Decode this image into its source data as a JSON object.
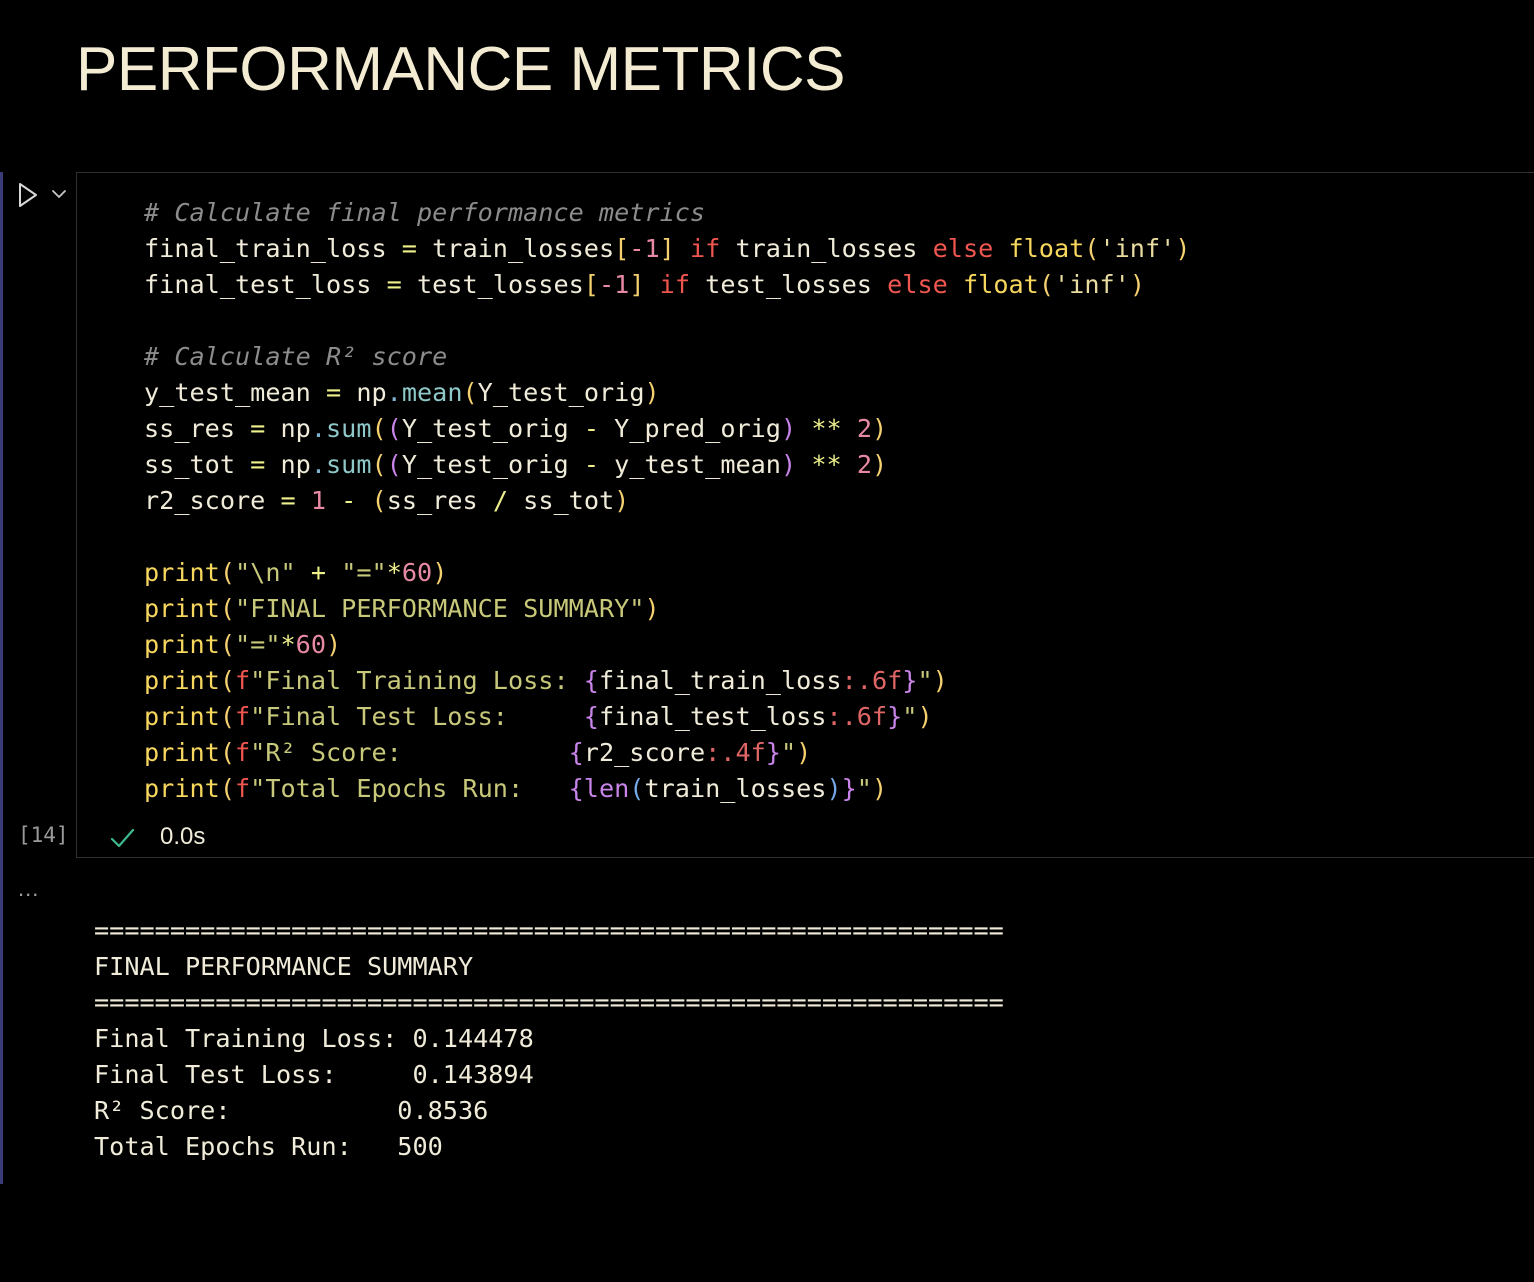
{
  "heading": "PERFORMANCE METRICS",
  "cell": {
    "execution_count": "[14]",
    "status": "0.0s",
    "output_collapse_label": "...",
    "code": {
      "l1": {
        "comment": "# Calculate final performance metrics"
      },
      "l2": {
        "a": "final_train_loss ",
        "b": "=",
        "c": " train_losses",
        "d": "[",
        "e": "-",
        "f": "1",
        "g": "]",
        "h": " ",
        "i": "if",
        "j": " train_losses ",
        "k": "else",
        "l": " ",
        "m": "float",
        "n": "(",
        "o": "'inf'",
        "p": ")"
      },
      "l3": {
        "a": "final_test_loss ",
        "b": "=",
        "c": " test_losses",
        "d": "[",
        "e": "-",
        "f": "1",
        "g": "]",
        "h": " ",
        "i": "if",
        "j": " test_losses ",
        "k": "else",
        "l": " ",
        "m": "float",
        "n": "(",
        "o": "'inf'",
        "p": ")"
      },
      "l5": {
        "comment": "# Calculate R² score"
      },
      "l6": {
        "a": "y_test_mean ",
        "b": "=",
        "c": " np",
        "d": ".",
        "e": "mean",
        "f": "(",
        "g": "Y_test_orig",
        "h": ")"
      },
      "l7": {
        "a": "ss_res ",
        "b": "=",
        "c": " np",
        "d": ".",
        "e": "sum",
        "f": "(",
        "g": "(",
        "h": "Y_test_orig ",
        "i": "-",
        "j": " Y_pred_orig",
        "k": ")",
        "l": " ",
        "m": "**",
        "n": " ",
        "o": "2",
        "p": ")"
      },
      "l8": {
        "a": "ss_tot ",
        "b": "=",
        "c": " np",
        "d": ".",
        "e": "sum",
        "f": "(",
        "g": "(",
        "h": "Y_test_orig ",
        "i": "-",
        "j": " y_test_mean",
        "k": ")",
        "l": " ",
        "m": "**",
        "n": " ",
        "o": "2",
        "p": ")"
      },
      "l9": {
        "a": "r2_score ",
        "b": "=",
        "c": " ",
        "d": "1",
        "e": " ",
        "f": "-",
        "g": " ",
        "h": "(",
        "i": "ss_res ",
        "j": "/",
        "k": " ss_tot",
        "l": ")"
      },
      "l11": {
        "a": "print",
        "b": "(",
        "c": "\"\\n\"",
        "d": " ",
        "e": "+",
        "f": " ",
        "g": "\"=\"",
        "h": "*",
        "i": "60",
        "j": ")"
      },
      "l12": {
        "a": "print",
        "b": "(",
        "c": "\"FINAL PERFORMANCE SUMMARY\"",
        "d": ")"
      },
      "l13": {
        "a": "print",
        "b": "(",
        "c": "\"=\"",
        "d": "*",
        "e": "60",
        "f": ")"
      },
      "l14": {
        "a": "print",
        "b": "(",
        "c": "f",
        "d": "\"Final Training Loss: ",
        "e": "{",
        "f": "final_train_loss",
        "g": ":.6f",
        "h": "}",
        "i": "\"",
        "j": ")"
      },
      "l15": {
        "a": "print",
        "b": "(",
        "c": "f",
        "d": "\"Final Test Loss:     ",
        "e": "{",
        "f": "final_test_loss",
        "g": ":.6f",
        "h": "}",
        "i": "\"",
        "j": ")"
      },
      "l16": {
        "a": "print",
        "b": "(",
        "c": "f",
        "d": "\"R² Score:           ",
        "e": "{",
        "f": "r2_score",
        "g": ":.4f",
        "h": "}",
        "i": "\"",
        "j": ")"
      },
      "l17": {
        "a": "print",
        "b": "(",
        "c": "f",
        "d": "\"Total Epochs Run:   ",
        "e": "{",
        "f": "len",
        "g": "(",
        "h": "train_losses",
        "i": ")",
        "j": "}",
        "k": "\"",
        "l": ")"
      }
    },
    "output_lines": [
      "============================================================",
      "FINAL PERFORMANCE SUMMARY",
      "============================================================",
      "Final Training Loss: 0.144478",
      "Final Test Loss:     0.143894",
      "R² Score:           0.8536",
      "Total Epochs Run:   500"
    ]
  },
  "icons": {
    "run": "play-icon",
    "expand": "chevron-down-icon",
    "status": "check-icon"
  },
  "colors": {
    "background": "#000000",
    "heading": "#f3ecd3",
    "comment": "#8c8c8c",
    "keyword": "#f0564f",
    "function": "#f7d75d",
    "string": "#c8c87a",
    "number": "#e88aa4",
    "brace": "#c884e8",
    "check": "#3fb98c",
    "cell_accent": "#3b3b78"
  }
}
